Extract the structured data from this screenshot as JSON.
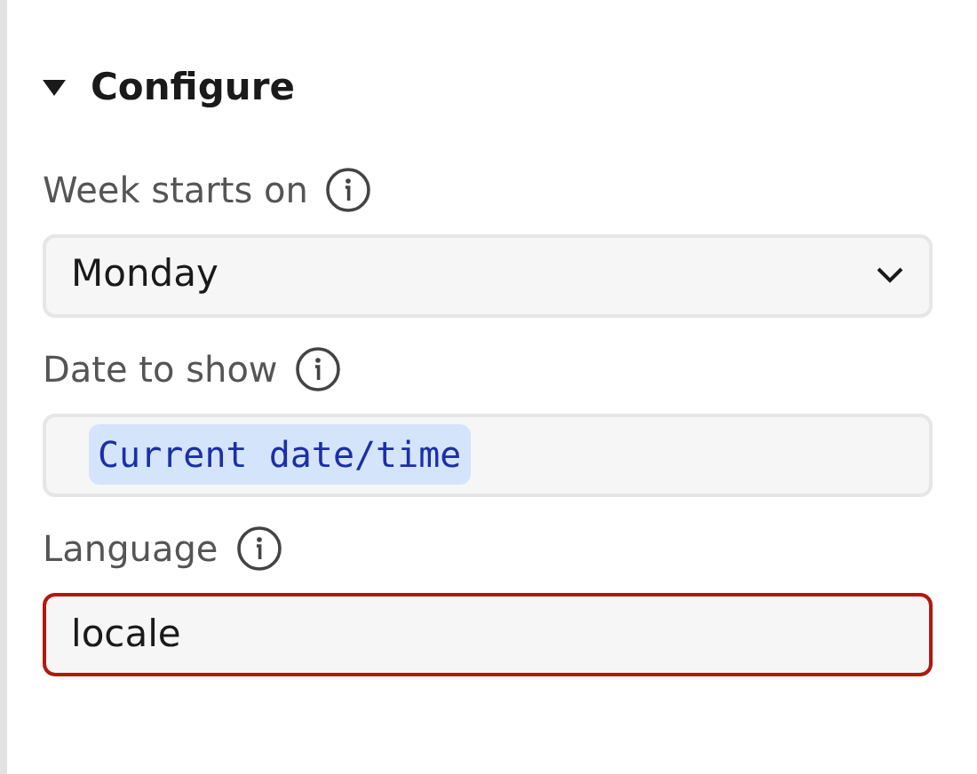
{
  "section": {
    "title": "Configure",
    "expanded": true
  },
  "fields": [
    {
      "kind": "select",
      "label": "Week starts on",
      "value": "Monday",
      "invalid": false
    },
    {
      "kind": "token",
      "label": "Date to show",
      "value": "Current date/time",
      "invalid": false
    },
    {
      "kind": "text",
      "label": "Language",
      "value": "locale",
      "invalid": true
    }
  ]
}
